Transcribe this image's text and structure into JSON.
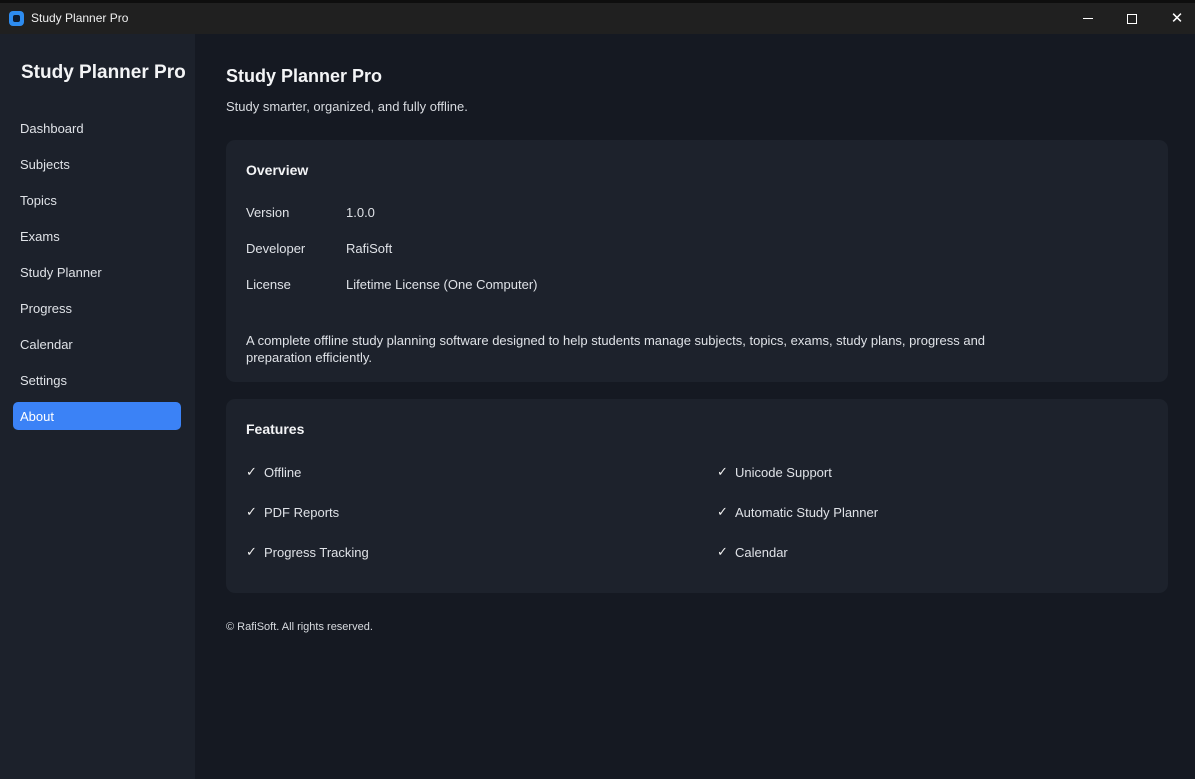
{
  "window": {
    "title": "Study Planner Pro",
    "minimize_icon": "minimize-icon",
    "maximize_icon": "maximize-icon",
    "close_icon": "close-icon"
  },
  "sidebar": {
    "brand": "Study Planner Pro",
    "items": [
      {
        "label": "Dashboard",
        "active": false
      },
      {
        "label": "Subjects",
        "active": false
      },
      {
        "label": "Topics",
        "active": false
      },
      {
        "label": "Exams",
        "active": false
      },
      {
        "label": "Study Planner",
        "active": false
      },
      {
        "label": "Progress",
        "active": false
      },
      {
        "label": "Calendar",
        "active": false
      },
      {
        "label": "Settings",
        "active": false
      },
      {
        "label": "About",
        "active": true
      }
    ]
  },
  "main": {
    "title": "Study Planner Pro",
    "subtitle": "Study smarter, organized, and fully offline.",
    "overview": {
      "title": "Overview",
      "rows": [
        {
          "label": "Version",
          "value": "1.0.0"
        },
        {
          "label": "Developer",
          "value": "RafiSoft"
        },
        {
          "label": "License",
          "value": "Lifetime License (One Computer)"
        }
      ],
      "description": "A complete offline study planning software designed to help students manage subjects, topics, exams, study plans, progress and preparation efficiently."
    },
    "features": {
      "title": "Features",
      "check_mark": "✓",
      "items": [
        "Offline",
        "Unicode Support",
        "PDF Reports",
        "Automatic Study Planner",
        "Progress Tracking",
        "Calendar"
      ]
    },
    "footer": "© RafiSoft. All rights reserved."
  },
  "colors": {
    "accent": "#3b82f6",
    "sidebar_bg": "#1c212b",
    "main_bg": "#151922",
    "card_bg": "#1d222c"
  }
}
